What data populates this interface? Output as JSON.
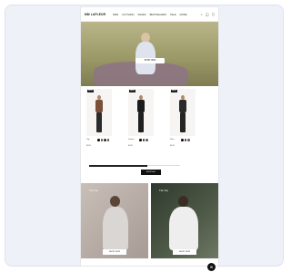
{
  "brand": {
    "logo": "MM LAFLEUR"
  },
  "nav": {
    "links": [
      "NEW",
      "CLOTHING",
      "SHOES",
      "BESTSELLERS",
      "SALE",
      "MORE"
    ],
    "icons": [
      "search-icon",
      "account-icon",
      "bag-icon"
    ]
  },
  "hero": {
    "button_label": "SHOP NOW"
  },
  "products": [
    {
      "badge": "NEW",
      "name": "Top",
      "price": "$185",
      "colors": [
        "#111111",
        "#7a4a3a",
        "#333333",
        "#555555"
      ],
      "top_color": "#7b4f3a",
      "leg_color": "#2b2b2b"
    },
    {
      "badge": "NEW",
      "name": "Jacket",
      "price": "$245",
      "colors": [
        "#111111",
        "#444444",
        "#666666"
      ],
      "top_color": "#1b1b1b",
      "leg_color": "#1f1f1f"
    },
    {
      "badge": "NEW",
      "name": "Pant",
      "price": "$195",
      "colors": [
        "#111111",
        "#444444",
        "#666666"
      ],
      "top_color": "#2a2a2a",
      "leg_color": "#252525"
    }
  ],
  "carousel": {
    "shop_all_label": "SHOP ALL"
  },
  "features": [
    {
      "title": "The Top",
      "button_label": "SHOP NOW"
    },
    {
      "title": "The Top",
      "button_label": "SHOP NOW"
    }
  ],
  "footer": {
    "text": "",
    "chat_icon": "chat-icon"
  }
}
